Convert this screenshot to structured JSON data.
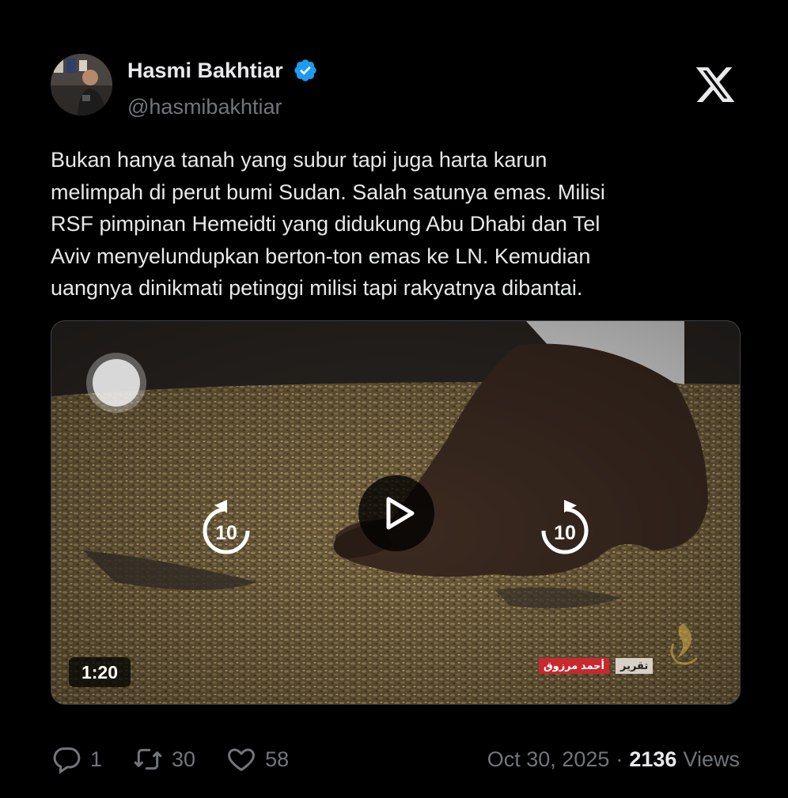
{
  "author": {
    "name": "Hasmi Bakhtiar",
    "handle": "@hasmibakhtiar",
    "verified": true
  },
  "tweet": {
    "lines": [
      "Bukan hanya tanah yang subur tapi juga harta karun",
      "melimpah di perut bumi Sudan. Salah satunya emas. Milisi",
      "RSF pimpinan Hemeidti yang didukung Abu Dhabi dan Tel",
      "Aviv menyelundupkan berton-ton emas ke LN. Kemudian",
      "uangnya dinikmati petinggi milisi tapi rakyatnya dibantai."
    ]
  },
  "video": {
    "duration": "1:20",
    "rewind_seconds": "10",
    "forward_seconds": "10",
    "caption_label": "تقرير",
    "caption_name": "أحمد مرزوق"
  },
  "stats": {
    "replies": "1",
    "reposts": "30",
    "likes": "58",
    "date": "Oct 30, 2025",
    "separator": "·",
    "views_count": "2136",
    "views_label": "Views"
  },
  "colors": {
    "background": "#000000",
    "text": "#e7e9ea",
    "muted": "#71767b",
    "verified": "#1d9bf0"
  },
  "icons": {
    "verified": "verified-badge-icon",
    "brand": "x-logo-icon",
    "reply": "reply-icon",
    "repost": "repost-icon",
    "like": "heart-icon",
    "play": "play-icon",
    "rewind": "rewind-10-icon",
    "forward": "forward-10-icon"
  }
}
